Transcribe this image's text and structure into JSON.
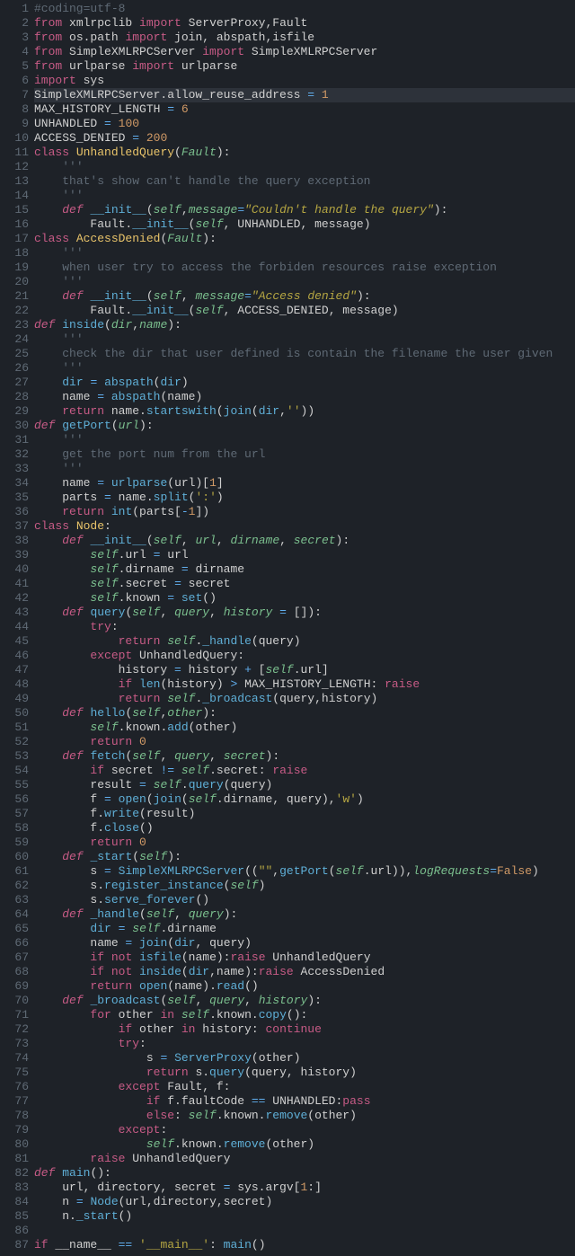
{
  "lines": [
    "<span class='c1'>#coding=utf-8</span>",
    "<span class='kw'>from</span> xmlrpclib <span class='kw'>import</span> ServerProxy,Fault",
    "<span class='kw'>from</span> os.path <span class='kw'>import</span> join, abspath,isfile",
    "<span class='kw'>from</span> SimpleXMLRPCServer <span class='kw'>import</span> SimpleXMLRPCServer",
    "<span class='kw'>from</span> urlparse <span class='kw'>import</span> urlparse",
    "<span class='kw'>import</span> sys",
    "SimpleXMLRPCServer.allow_reuse_address <span class='op'>=</span> <span class='num'>1</span>",
    "MAX_HISTORY_LENGTH <span class='op'>=</span> <span class='num'>6</span>",
    "UNHANDLED <span class='op'>=</span> <span class='num'>100</span>",
    "ACCESS_DENIED <span class='op'>=</span> <span class='num'>200</span>",
    "<span class='kw'>class</span> <span class='cls'>UnhandledQuery</span>(<span class='prm'>Fault</span>):",
    "    <span class='c1'>'''</span>",
    "    <span class='c1'>that's show can't handle the query exception</span>",
    "    <span class='c1'>'''</span>",
    "    <span class='kw2'>def</span> <span class='fn'>__init__</span>(<span class='prm'>self</span>,<span class='prm'>message</span><span class='op'>=</span><span class='s2'>\"Couldn't handle the query\"</span>):",
    "        Fault.<span class='fn'>__init__</span>(<span class='prm'>self</span>, UNHANDLED, message)",
    "<span class='kw'>class</span> <span class='cls'>AccessDenied</span>(<span class='prm'>Fault</span>):",
    "    <span class='c1'>'''</span>",
    "    <span class='c1'>when user try to access the forbiden resources raise exception</span>",
    "    <span class='c1'>'''</span>",
    "    <span class='kw2'>def</span> <span class='fn'>__init__</span>(<span class='prm'>self</span>, <span class='prm'>message</span><span class='op'>=</span><span class='s2'>\"Access denied\"</span>):",
    "        Fault.<span class='fn'>__init__</span>(<span class='prm'>self</span>, ACCESS_DENIED, message)",
    "<span class='kw2'>def</span> <span class='fn'>inside</span>(<span class='prm'>dir</span>,<span class='prm'>name</span>):",
    "    <span class='c1'>'''</span>",
    "    <span class='c1'>check the dir that user defined is contain the filename the user given</span>",
    "    <span class='c1'>'''</span>",
    "    <span class='bi'>dir</span> <span class='op'>=</span> <span class='fn'>abspath</span>(<span class='bi'>dir</span>)",
    "    name <span class='op'>=</span> <span class='fn'>abspath</span>(name)",
    "    <span class='kw'>return</span> name.<span class='fn'>startswith</span>(<span class='fn'>join</span>(<span class='bi'>dir</span>,<span class='str'>''</span>))",
    "<span class='kw2'>def</span> <span class='fn'>getPort</span>(<span class='prm'>url</span>):",
    "    <span class='c1'>'''</span>",
    "    <span class='c1'>get the port num from the url</span>",
    "    <span class='c1'>'''</span>",
    "    name <span class='op'>=</span> <span class='fn'>urlparse</span>(url)[<span class='num'>1</span>]",
    "    parts <span class='op'>=</span> name.<span class='fn'>split</span>(<span class='str'>':'</span>)",
    "    <span class='kw'>return</span> <span class='bi'>int</span>(parts[<span class='op'>-</span><span class='num'>1</span>])",
    "<span class='kw'>class</span> <span class='cls'>Node</span>:",
    "    <span class='kw2'>def</span> <span class='fn'>__init__</span>(<span class='prm'>self</span>, <span class='prm'>url</span>, <span class='prm'>dirname</span>, <span class='prm'>secret</span>):",
    "        <span class='prm'>self</span>.url <span class='op'>=</span> url",
    "        <span class='prm'>self</span>.dirname <span class='op'>=</span> dirname",
    "        <span class='prm'>self</span>.secret <span class='op'>=</span> secret",
    "        <span class='prm'>self</span>.known <span class='op'>=</span> <span class='bi'>set</span>()",
    "    <span class='kw2'>def</span> <span class='fn'>query</span>(<span class='prm'>self</span>, <span class='prm'>query</span>, <span class='prm'>history</span> <span class='op'>=</span> []):",
    "        <span class='kw'>try</span>:",
    "            <span class='kw'>return</span> <span class='prm'>self</span>.<span class='fn'>_handle</span>(query)",
    "        <span class='kw'>except</span> UnhandledQuery:",
    "            history <span class='op'>=</span> history <span class='op'>+</span> [<span class='prm'>self</span>.url]",
    "            <span class='kw'>if</span> <span class='bi'>len</span>(history) <span class='op'>&gt;</span> MAX_HISTORY_LENGTH: <span class='kw'>raise</span>",
    "            <span class='kw'>return</span> <span class='prm'>self</span>.<span class='fn'>_broadcast</span>(query,history)",
    "    <span class='kw2'>def</span> <span class='fn'>hello</span>(<span class='prm'>self</span>,<span class='prm'>other</span>):",
    "        <span class='prm'>self</span>.known.<span class='fn'>add</span>(other)",
    "        <span class='kw'>return</span> <span class='num'>0</span>",
    "    <span class='kw2'>def</span> <span class='fn'>fetch</span>(<span class='prm'>self</span>, <span class='prm'>query</span>, <span class='prm'>secret</span>):",
    "        <span class='kw'>if</span> secret <span class='op'>!=</span> <span class='prm'>self</span>.secret: <span class='kw'>raise</span>",
    "        result <span class='op'>=</span> <span class='prm'>self</span>.<span class='fn'>query</span>(query)",
    "        f <span class='op'>=</span> <span class='bi'>open</span>(<span class='fn'>join</span>(<span class='prm'>self</span>.dirname, query),<span class='str'>'w'</span>)",
    "        f.<span class='fn'>write</span>(result)",
    "        f.<span class='fn'>close</span>()",
    "        <span class='kw'>return</span> <span class='num'>0</span>",
    "    <span class='kw2'>def</span> <span class='fn'>_start</span>(<span class='prm'>self</span>):",
    "        s <span class='op'>=</span> <span class='fn'>SimpleXMLRPCServer</span>((<span class='str'>\"\"</span>,<span class='fn'>getPort</span>(<span class='prm'>self</span>.url)),<span class='prm'>logRequests</span><span class='op'>=</span><span class='num'>False</span>)",
    "        s.<span class='fn'>register_instance</span>(<span class='prm'>self</span>)",
    "        s.<span class='fn'>serve_forever</span>()",
    "    <span class='kw2'>def</span> <span class='fn'>_handle</span>(<span class='prm'>self</span>, <span class='prm'>query</span>):",
    "        <span class='bi'>dir</span> <span class='op'>=</span> <span class='prm'>self</span>.dirname",
    "        name <span class='op'>=</span> <span class='fn'>join</span>(<span class='bi'>dir</span>, query)",
    "        <span class='kw'>if</span> <span class='kw'>not</span> <span class='fn'>isfile</span>(name):<span class='kw'>raise</span> UnhandledQuery",
    "        <span class='kw'>if</span> <span class='kw'>not</span> <span class='fn'>inside</span>(<span class='bi'>dir</span>,name):<span class='kw'>raise</span> AccessDenied",
    "        <span class='kw'>return</span> <span class='bi'>open</span>(name).<span class='fn'>read</span>()",
    "    <span class='kw2'>def</span> <span class='fn'>_broadcast</span>(<span class='prm'>self</span>, <span class='prm'>query</span>, <span class='prm'>history</span>):",
    "        <span class='kw'>for</span> other <span class='kw'>in</span> <span class='prm'>self</span>.known.<span class='fn'>copy</span>():",
    "            <span class='kw'>if</span> other <span class='kw'>in</span> history: <span class='kw'>continue</span>",
    "            <span class='kw'>try</span>:",
    "                s <span class='op'>=</span> <span class='fn'>ServerProxy</span>(other)",
    "                <span class='kw'>return</span> s.<span class='fn'>query</span>(query, history)",
    "            <span class='kw'>except</span> Fault, f:",
    "                <span class='kw'>if</span> f.faultCode <span class='op'>==</span> UNHANDLED:<span class='kw'>pass</span>",
    "                <span class='kw'>else</span>: <span class='prm'>self</span>.known.<span class='fn'>remove</span>(other)",
    "            <span class='kw'>except</span>:",
    "                <span class='prm'>self</span>.known.<span class='fn'>remove</span>(other)",
    "        <span class='kw'>raise</span> UnhandledQuery",
    "<span class='kw2'>def</span> <span class='fn'>main</span>():",
    "    url, directory, secret <span class='op'>=</span> sys.argv[<span class='num'>1</span>:]",
    "    n <span class='op'>=</span> <span class='fn'>Node</span>(url,directory,secret)",
    "    n.<span class='fn'>_start</span>()",
    "",
    "<span class='kw'>if</span> __name__ <span class='op'>==</span> <span class='str'>'__main__'</span>: <span class='fn'>main</span>()"
  ]
}
